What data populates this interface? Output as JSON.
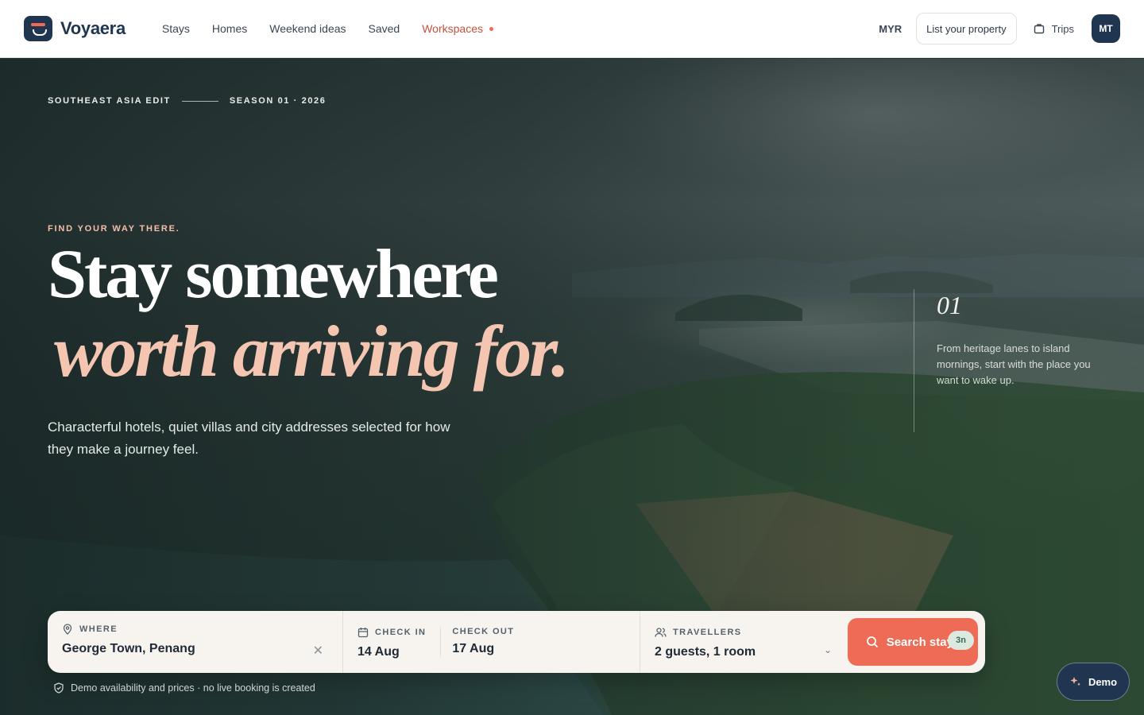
{
  "brand": {
    "name": "Voyaera"
  },
  "nav": {
    "items": [
      {
        "label": "Stays"
      },
      {
        "label": "Homes"
      },
      {
        "label": "Weekend ideas"
      },
      {
        "label": "Saved"
      }
    ],
    "active": {
      "label": "Workspaces"
    }
  },
  "header": {
    "currency": "MYR",
    "list_property": "List your property",
    "trips": "Trips",
    "avatar_initials": "MT"
  },
  "hero": {
    "edition_left": "SOUTHEAST ASIA EDIT",
    "edition_right": "SEASON 01 · 2026",
    "eyebrow": "FIND YOUR WAY THERE.",
    "title_line1": "Stay somewhere",
    "title_line2": "worth arriving for.",
    "subtitle": "Characterful hotels, quiet villas and city addresses selected for how they make a journey feel.",
    "side_number": "01",
    "side_text": "From heritage lanes to island mornings, start with the place you want to wake up."
  },
  "search": {
    "where_label": "WHERE",
    "where_value": "George Town, Penang",
    "checkin_label": "CHECK IN",
    "checkin_value": "14 Aug",
    "checkout_label": "CHECK OUT",
    "checkout_value": "17 Aug",
    "nights": "3n",
    "travellers_label": "TRAVELLERS",
    "travellers_value": "2 guests, 1 room",
    "button": "Search stays"
  },
  "disclaimer": "Demo availability and prices · no live booking is created",
  "demo_button": "Demo",
  "colors": {
    "accent": "#ee6c56",
    "brand": "#1f3550",
    "active_nav": "#c4513c"
  }
}
